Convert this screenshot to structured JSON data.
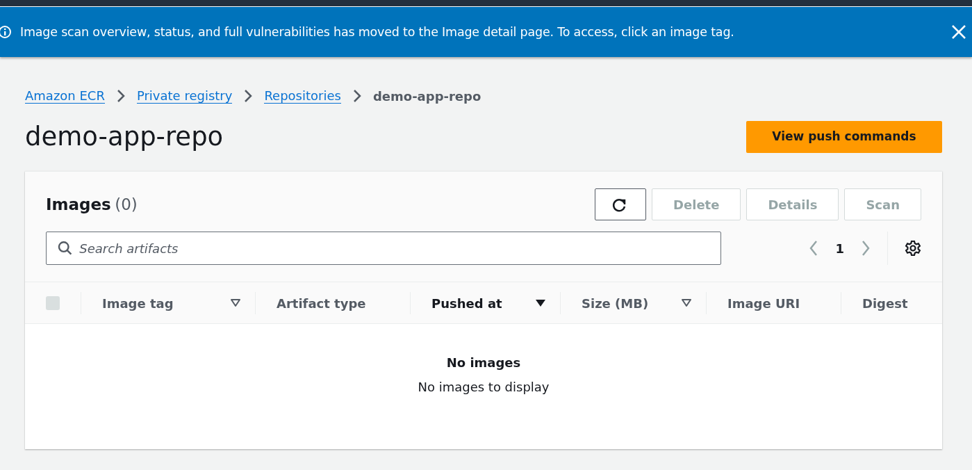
{
  "flash": {
    "message": "Image scan overview, status, and full vulnerabilities has moved to the Image detail page. To access, click an image tag."
  },
  "breadcrumbs": [
    {
      "label": "Amazon ECR",
      "current": false
    },
    {
      "label": "Private registry",
      "current": false
    },
    {
      "label": "Repositories",
      "current": false
    },
    {
      "label": "demo-app-repo",
      "current": true
    }
  ],
  "page_title": "demo-app-repo",
  "primary_action": "View push commands",
  "images_panel": {
    "title": "Images",
    "count": "(0)",
    "actions": [
      {
        "kind": "refresh",
        "disabled": false
      },
      {
        "kind": "text",
        "label": "Delete",
        "disabled": true
      },
      {
        "kind": "text",
        "label": "Details",
        "disabled": true
      },
      {
        "kind": "text",
        "label": "Scan",
        "disabled": true
      }
    ],
    "search": {
      "placeholder": "Search artifacts"
    },
    "pagination": {
      "previous_disabled": true,
      "page": "1",
      "next_disabled": true
    },
    "select_all": {
      "checked": false,
      "disabled": true
    },
    "columns": [
      {
        "label": "Image tag",
        "sortable": true,
        "selected": false
      },
      {
        "label": "Artifact type",
        "sortable": false,
        "selected": false
      },
      {
        "label": "Pushed at",
        "sortable": true,
        "selected": true
      },
      {
        "label": "Size (MB)",
        "sortable": true,
        "selected": false
      },
      {
        "label": "Image URI",
        "sortable": false,
        "selected": false
      },
      {
        "label": "Digest",
        "sortable": false,
        "selected": false
      }
    ],
    "empty_state": {
      "title": "No images",
      "message": "No images to display"
    }
  }
}
